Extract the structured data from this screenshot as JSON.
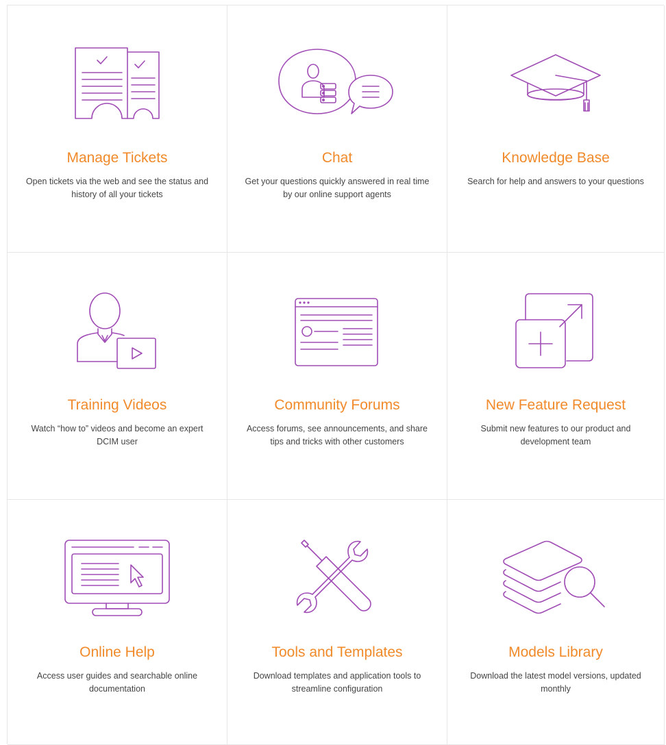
{
  "cards": [
    {
      "title": "Manage Tickets",
      "description": "Open tickets via the web and see the status and history of all your tickets",
      "icon": "tickets-icon"
    },
    {
      "title": "Chat",
      "description": "Get your questions quickly answered in real time by our online support agents",
      "icon": "chat-icon"
    },
    {
      "title": "Knowledge Base",
      "description": "Search for help and answers to your questions",
      "icon": "graduation-cap-icon"
    },
    {
      "title": "Training Videos",
      "description": "Watch “how to” videos and become an expert DCIM user",
      "icon": "training-video-icon"
    },
    {
      "title": "Community Forums",
      "description": "Access forums, see announcements, and share tips and tricks with other customers",
      "icon": "forum-window-icon"
    },
    {
      "title": "New Feature Request",
      "description": "Submit new features to our product and development team",
      "icon": "new-feature-icon"
    },
    {
      "title": "Online Help",
      "description": "Access user guides and searchable online documentation",
      "icon": "monitor-help-icon"
    },
    {
      "title": "Tools and Templates",
      "description": "Download templates and application tools to streamline configuration",
      "icon": "tools-icon"
    },
    {
      "title": "Models Library",
      "description": "Download the latest model versions, updated monthly",
      "icon": "models-library-icon"
    }
  ],
  "colors": {
    "accent": "#f08a2a",
    "icon": "#a04cb5",
    "text": "#444444",
    "border": "#e6e6e6"
  }
}
